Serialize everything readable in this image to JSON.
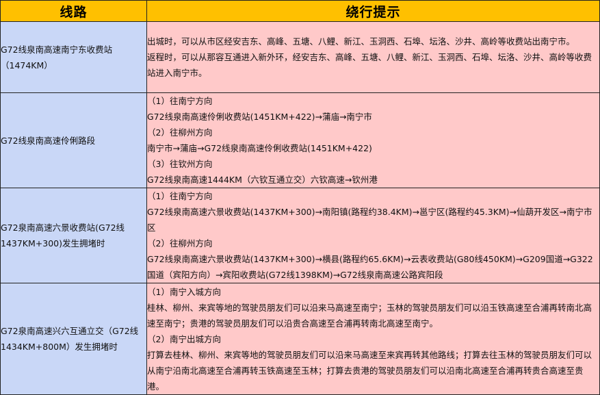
{
  "header": {
    "route": "线路",
    "tips": "绕行提示"
  },
  "rows": [
    {
      "route": "G72线泉南高速南宁东收费站（1474KM）",
      "tips": [
        "出城时，可以从市区经安吉东、高峰、五塘、八鲤、新江、玉洞西、石埠、坛洛、沙井、高岭等收费站出南宁市。",
        "返程时，可以从那容互通进入新外环，经安吉东、高峰、五塘、八鲤、新江、玉洞西、石埠、坛洛、沙井、高岭等收费站进入南宁市。"
      ]
    },
    {
      "route": "G72线泉南高速伶俐路段",
      "tips": [
        "（1）往南宁方向",
        "G72线泉南高速伶俐收费站(1451KM+422)→蒲庙→南宁市",
        "（2）往柳州方向",
        "南宁市→蒲庙→G72线泉南高速伶俐收费站(1451KM+422)",
        "（3）往钦州方向",
        "G72线泉南高速1444KM（六钦互通立交）六钦高速→钦州港"
      ]
    },
    {
      "route": "G72泉南高速六景收费站(G72线1437KM+300)发生拥堵时",
      "tips": [
        "（1）往南宁方向",
        "G72线泉南高速六景收费站(1437KM+300)→南阳镇(路程约38.4KM)→邕宁区(路程约45.3KM)→仙葫开发区→南宁市区",
        "（2）往柳州方向",
        "G72线泉南高速六景收费站(1437KM+300)→横县(路程约65.6KM)→云表收费站(G80线450KM)→G209国道→G322国道（宾阳方向）→宾阳收费站(G72线1398KM)→G72线泉南高速公路宾阳段"
      ]
    },
    {
      "route": "G72泉南高速兴六互通立交（G72线1434KM+800M）发生拥堵时",
      "tips": [
        "（1）南宁入城方向",
        "桂林、柳州、来宾等地的驾驶员朋友们可以沿来马高速至南宁；玉林的驾驶员朋友们可以沿玉铁高速至合浦再转南北高速至南宁；贵港的驾驶员朋友们可以沿贵合高速至合浦再转南北高速至南宁。",
        "（2）南宁出城方向",
        "打算去桂林、柳州、来宾等地的驾驶员朋友们可以沿来马高速至来宾再转其他路线；打算去往玉林的驾驶员朋友们可以从南宁沿南北高速至合浦再转玉铁高速至玉林；打算去贵港的驾驶员朋友们可以沿南北高速至合浦再转贵合高速至贵港。"
      ]
    }
  ]
}
